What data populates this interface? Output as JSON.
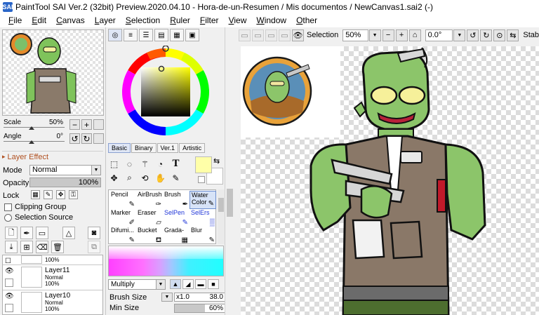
{
  "window": {
    "title": "PaintTool SAI Ver.2 (32bit) Preview.2020.04.10 - Hora-de-un-Resumen / Mis documentos / NewCanvas1.sai2 (-)",
    "icon": "SAI"
  },
  "menu": [
    {
      "u": "F",
      "rest": "ile"
    },
    {
      "u": "E",
      "rest": "dit"
    },
    {
      "u": "C",
      "rest": "anvas"
    },
    {
      "u": "L",
      "rest": "ayer"
    },
    {
      "u": "S",
      "rest": "election"
    },
    {
      "u": "R",
      "rest": "uler"
    },
    {
      "u": "F",
      "rest": "ilter"
    },
    {
      "u": "V",
      "rest": "iew"
    },
    {
      "u": "W",
      "rest": "indow"
    },
    {
      "u": "O",
      "rest": "ther"
    }
  ],
  "navigator": {
    "scale_label": "Scale",
    "scale_value": "50%",
    "scale_level": 0.5,
    "angle_label": "Angle",
    "angle_value": "0°",
    "angle_level": 0.5,
    "btn_minus": "−",
    "btn_plus": "+",
    "btn_reset": "↺",
    "btn_redo": "↻"
  },
  "layer_effect": {
    "header": "Layer Effect",
    "arrow": "▸"
  },
  "layer_props": {
    "mode_label": "Mode",
    "mode_value": "Normal",
    "opacity_label": "Opacity",
    "opacity_value": "100%",
    "opacity_level": 1.0,
    "lock_label": "Lock",
    "clipping_label": "Clipping Group",
    "selection_source_label": "Selection Source"
  },
  "layers": [
    {
      "name": "",
      "mode": "",
      "opacity": "100%",
      "note": "partial"
    },
    {
      "name": "Layer11",
      "mode": "Normal",
      "opacity": "100%"
    },
    {
      "name": "Layer10",
      "mode": "Normal",
      "opacity": "100%"
    }
  ],
  "color_tabs": [
    "Basic",
    "Binary",
    "Ver.1",
    "Artistic"
  ],
  "active_color_tab": "Basic",
  "colors": {
    "primary": "#ffffa8",
    "secondary": "#ffffff"
  },
  "brush_tools": [
    {
      "label": "Pencil",
      "icon": "✎"
    },
    {
      "label": "AirBrush",
      "icon": "✑"
    },
    {
      "label": "Brush",
      "icon": "✒"
    },
    {
      "label": "Water Color",
      "icon": "✎",
      "selected": true
    },
    {
      "label": "Marker",
      "icon": "✐"
    },
    {
      "label": "Eraser",
      "icon": "▱"
    },
    {
      "label": "SelPen",
      "icon": "✎",
      "blue": true
    },
    {
      "label": "SelErs",
      "icon": "▒",
      "blue": true
    },
    {
      "label": "Difumi...",
      "icon": "✎"
    },
    {
      "label": "Bucket",
      "icon": "⛾"
    },
    {
      "label": "Grada-",
      "icon": "▦"
    },
    {
      "label": "Blur",
      "icon": "✎"
    }
  ],
  "brush_settings": {
    "blend_mode": "Multiply",
    "size_label": "Brush Size",
    "size_multiplier": "x1.0",
    "size_value": "38.0",
    "min_size_label": "Min Size",
    "min_size_value": "60%",
    "min_size_level": 0.6
  },
  "canvas_toolbar": {
    "selection_label": "Selection",
    "zoom": "50%",
    "angle": "0.0°",
    "stab_label": "Stab"
  }
}
